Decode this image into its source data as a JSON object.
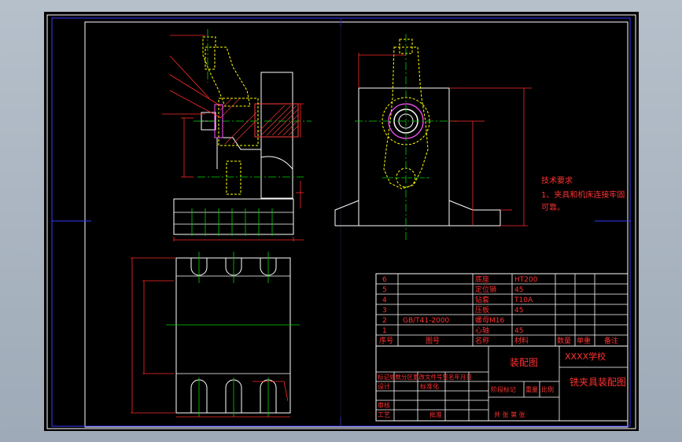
{
  "title_block": {
    "drawing_name": "装配图",
    "school": "XXXX学校",
    "assembly_title": "铣夹具装配图",
    "header_labels": {
      "seq": "序号",
      "code": "图号",
      "name": "名称",
      "qty": "数量",
      "material": "材料",
      "weight": "单重",
      "remark": "备注"
    },
    "approval_labels": {
      "mark_row": "标记处数分区更改文件号签名年月日",
      "design": "设计",
      "standard": "标准化",
      "stage_mark": "阶段标记",
      "weight": "重量",
      "scale": "比例",
      "review": "审核",
      "process": "工艺",
      "approve": "批准",
      "sheets": "共  张 第  张"
    }
  },
  "parts_list": [
    {
      "no": "6",
      "code": "",
      "name": "底座",
      "material": "HT200"
    },
    {
      "no": "5",
      "code": "",
      "name": "定位销",
      "material": "45"
    },
    {
      "no": "4",
      "code": "",
      "name": "钻套",
      "material": "T10A"
    },
    {
      "no": "3",
      "code": "",
      "name": "压板",
      "material": "45"
    },
    {
      "no": "2",
      "code": "GB/T41-2000",
      "name": "螺母M16",
      "material": ""
    },
    {
      "no": "1",
      "code": "",
      "name": "心轴",
      "material": "45"
    }
  ],
  "tech_requirements": {
    "heading": "技术要求",
    "line1": "1、夹具和机床连接牢固",
    "line2": "可靠。"
  },
  "colors": {
    "frame": "#ffffff",
    "border_blue": "#3a3aff",
    "outline": "#ffffff",
    "dimension": "#ff2a2a",
    "centerline": "#00d400",
    "hidden": "#ffff00",
    "hatch": "#ff3c3c",
    "purple": "#ff55ff",
    "text_red": "#ff3232",
    "background": "#000000",
    "app_background": "#a8b3bf"
  }
}
